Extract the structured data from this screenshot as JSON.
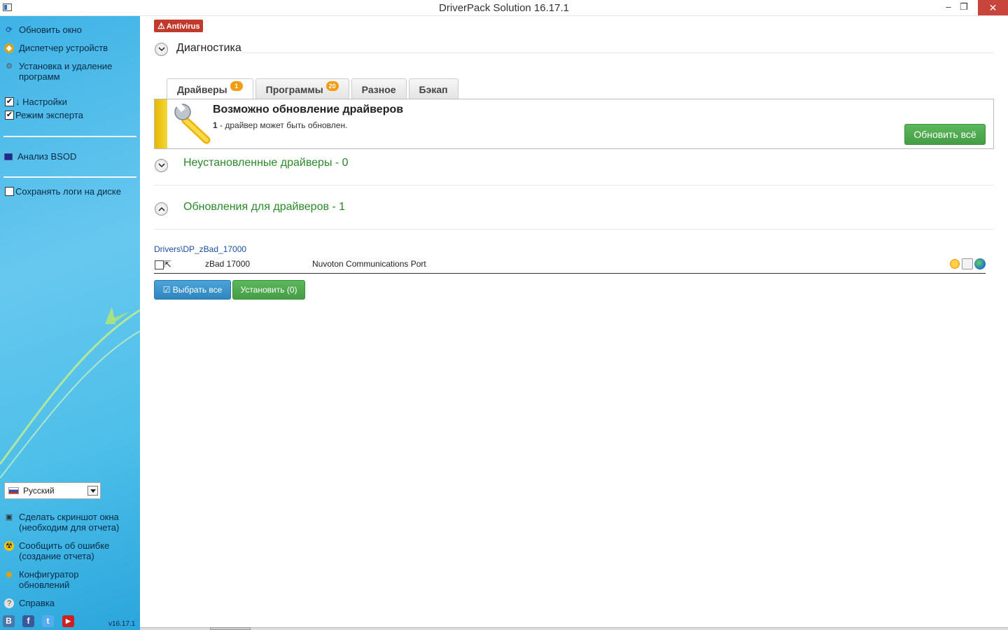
{
  "window": {
    "title": "DriverPack Solution 16.17.1",
    "minimize": "–",
    "maximize": "❐",
    "close": "✕"
  },
  "sidebar": {
    "refresh": "Обновить окно",
    "device_manager": "Диспетчер устройств",
    "install_remove": "Установка и удаление программ",
    "settings": "↓ Настройки",
    "expert_mode": "Режим эксперта",
    "bsod": "Анализ BSOD",
    "save_logs": "Сохранять логи на диске",
    "language": "Русский",
    "screenshot": "Сделать скриншот окна (необходим для отчета)",
    "report_error": "Сообщить об ошибке (создание отчета)",
    "configurator": "Конфигуратор обновлений",
    "help": "Справка",
    "version": "v16.17.1",
    "social": [
      "В",
      "f",
      "t",
      "▶"
    ]
  },
  "main": {
    "antivirus_badge": "Antivirus",
    "diagnostics": "Диагностика",
    "tabs": [
      {
        "label": "Драйверы",
        "badge": "1"
      },
      {
        "label": "Программы",
        "badge": "20"
      },
      {
        "label": "Разное",
        "badge": ""
      },
      {
        "label": "Бэкап",
        "badge": ""
      }
    ],
    "panel": {
      "title": "Возможно обновление драйверов",
      "count": "1",
      "desc": " - драйвер может быть обновлен.",
      "update_all": "Обновить всё"
    },
    "not_installed": "Неустановленные драйверы -   0",
    "updates": "Обновления для драйверов -   1",
    "driver_path": "Drivers\\DP_zBad_17000",
    "driver_row": {
      "name": "zBad 17000",
      "device": "Nuvoton Communications Port"
    },
    "select_all": "Выбрать все",
    "install": "Установить (0)"
  }
}
